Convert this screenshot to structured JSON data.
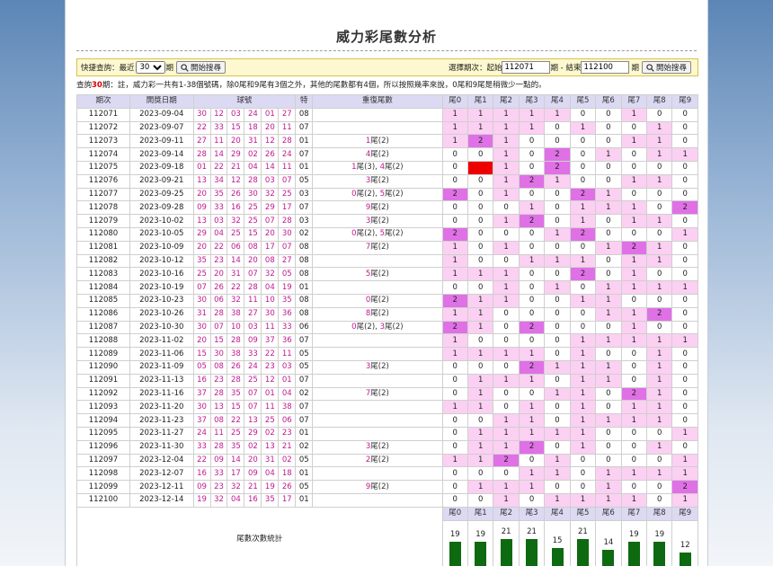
{
  "title": "威力彩尾數分析",
  "query": {
    "quick_label": "快捷查詢：最近",
    "quick_value": "30",
    "quick_options": [
      "30"
    ],
    "quick_suffix": "期",
    "search_label": "開始搜尋",
    "range_label": "選擇期次：起始",
    "range_start": "112071",
    "range_mid": "期 - 結束",
    "range_end": "112100",
    "range_suffix": "期"
  },
  "note": {
    "prefix": "查詢",
    "count": "30",
    "text": "期：註，威力彩一共有1-38個號碼，除0尾和9尾有3個之外，其他的尾數都有4個，所以按照幾率來說，0尾和9尾是稍微少一點的。"
  },
  "headers": [
    "期次",
    "開獎日期",
    "球號",
    "特",
    "重復尾數",
    "尾0",
    "尾1",
    "尾2",
    "尾3",
    "尾4",
    "尾5",
    "尾6",
    "尾7",
    "尾8",
    "尾9"
  ],
  "rows": [
    {
      "p": "112071",
      "d": "2023-09-04",
      "b": [
        "30",
        "12",
        "03",
        "24",
        "01",
        "27"
      ],
      "s": "08",
      "r": [],
      "t": [
        1,
        1,
        1,
        1,
        1,
        0,
        0,
        1,
        0,
        0
      ]
    },
    {
      "p": "112072",
      "d": "2023-09-07",
      "b": [
        "22",
        "33",
        "15",
        "18",
        "20",
        "11"
      ],
      "s": "07",
      "r": [],
      "t": [
        1,
        1,
        1,
        1,
        0,
        1,
        0,
        0,
        1,
        0
      ]
    },
    {
      "p": "112073",
      "d": "2023-09-11",
      "b": [
        "27",
        "11",
        "20",
        "31",
        "12",
        "28"
      ],
      "s": "01",
      "r": [
        {
          "n": "1",
          "c": "2"
        }
      ],
      "t": [
        1,
        2,
        1,
        0,
        0,
        0,
        0,
        1,
        1,
        0
      ]
    },
    {
      "p": "112074",
      "d": "2023-09-14",
      "b": [
        "28",
        "14",
        "29",
        "02",
        "26",
        "24"
      ],
      "s": "07",
      "r": [
        {
          "n": "4",
          "c": "2"
        }
      ],
      "t": [
        0,
        0,
        1,
        0,
        2,
        0,
        1,
        0,
        1,
        1
      ]
    },
    {
      "p": "112075",
      "d": "2023-09-18",
      "b": [
        "01",
        "22",
        "21",
        "04",
        "14",
        "11"
      ],
      "s": "01",
      "r": [
        {
          "n": "1",
          "c": "3"
        },
        {
          "n": "4",
          "c": "2"
        }
      ],
      "t": [
        0,
        3,
        1,
        0,
        2,
        0,
        0,
        0,
        0,
        0
      ]
    },
    {
      "p": "112076",
      "d": "2023-09-21",
      "b": [
        "13",
        "34",
        "12",
        "28",
        "03",
        "07"
      ],
      "s": "05",
      "r": [
        {
          "n": "3",
          "c": "2"
        }
      ],
      "t": [
        0,
        0,
        1,
        2,
        1,
        0,
        0,
        1,
        1,
        0
      ]
    },
    {
      "p": "112077",
      "d": "2023-09-25",
      "b": [
        "20",
        "35",
        "26",
        "30",
        "32",
        "25"
      ],
      "s": "03",
      "r": [
        {
          "n": "0",
          "c": "2"
        },
        {
          "n": "5",
          "c": "2"
        }
      ],
      "t": [
        2,
        0,
        1,
        0,
        0,
        2,
        1,
        0,
        0,
        0
      ]
    },
    {
      "p": "112078",
      "d": "2023-09-28",
      "b": [
        "09",
        "33",
        "16",
        "25",
        "29",
        "17"
      ],
      "s": "07",
      "r": [
        {
          "n": "9",
          "c": "2"
        }
      ],
      "t": [
        0,
        0,
        0,
        1,
        0,
        1,
        1,
        1,
        0,
        2
      ]
    },
    {
      "p": "112079",
      "d": "2023-10-02",
      "b": [
        "13",
        "03",
        "32",
        "25",
        "07",
        "28"
      ],
      "s": "03",
      "r": [
        {
          "n": "3",
          "c": "2"
        }
      ],
      "t": [
        0,
        0,
        1,
        2,
        0,
        1,
        0,
        1,
        1,
        0
      ]
    },
    {
      "p": "112080",
      "d": "2023-10-05",
      "b": [
        "29",
        "04",
        "25",
        "15",
        "20",
        "30"
      ],
      "s": "02",
      "r": [
        {
          "n": "0",
          "c": "2"
        },
        {
          "n": "5",
          "c": "2"
        }
      ],
      "t": [
        2,
        0,
        0,
        0,
        1,
        2,
        0,
        0,
        0,
        1
      ]
    },
    {
      "p": "112081",
      "d": "2023-10-09",
      "b": [
        "20",
        "22",
        "06",
        "08",
        "17",
        "07"
      ],
      "s": "08",
      "r": [
        {
          "n": "7",
          "c": "2"
        }
      ],
      "t": [
        1,
        0,
        1,
        0,
        0,
        0,
        1,
        2,
        1,
        0
      ]
    },
    {
      "p": "112082",
      "d": "2023-10-12",
      "b": [
        "35",
        "23",
        "14",
        "20",
        "08",
        "27"
      ],
      "s": "08",
      "r": [],
      "t": [
        1,
        0,
        0,
        1,
        1,
        1,
        0,
        1,
        1,
        0
      ]
    },
    {
      "p": "112083",
      "d": "2023-10-16",
      "b": [
        "25",
        "20",
        "31",
        "07",
        "32",
        "05"
      ],
      "s": "08",
      "r": [
        {
          "n": "5",
          "c": "2"
        }
      ],
      "t": [
        1,
        1,
        1,
        0,
        0,
        2,
        0,
        1,
        0,
        0
      ]
    },
    {
      "p": "112084",
      "d": "2023-10-19",
      "b": [
        "07",
        "26",
        "22",
        "28",
        "04",
        "19"
      ],
      "s": "01",
      "r": [],
      "t": [
        0,
        0,
        1,
        0,
        1,
        0,
        1,
        1,
        1,
        1
      ]
    },
    {
      "p": "112085",
      "d": "2023-10-23",
      "b": [
        "30",
        "06",
        "32",
        "11",
        "10",
        "35"
      ],
      "s": "08",
      "r": [
        {
          "n": "0",
          "c": "2"
        }
      ],
      "t": [
        2,
        1,
        1,
        0,
        0,
        1,
        1,
        0,
        0,
        0
      ]
    },
    {
      "p": "112086",
      "d": "2023-10-26",
      "b": [
        "31",
        "28",
        "38",
        "27",
        "30",
        "36"
      ],
      "s": "08",
      "r": [
        {
          "n": "8",
          "c": "2"
        }
      ],
      "t": [
        1,
        1,
        0,
        0,
        0,
        0,
        1,
        1,
        2,
        0
      ]
    },
    {
      "p": "112087",
      "d": "2023-10-30",
      "b": [
        "30",
        "07",
        "10",
        "03",
        "11",
        "33"
      ],
      "s": "06",
      "r": [
        {
          "n": "0",
          "c": "2"
        },
        {
          "n": "3",
          "c": "2"
        }
      ],
      "t": [
        2,
        1,
        0,
        2,
        0,
        0,
        0,
        1,
        0,
        0
      ]
    },
    {
      "p": "112088",
      "d": "2023-11-02",
      "b": [
        "20",
        "15",
        "28",
        "09",
        "37",
        "36"
      ],
      "s": "07",
      "r": [],
      "t": [
        1,
        0,
        0,
        0,
        0,
        1,
        1,
        1,
        1,
        1
      ]
    },
    {
      "p": "112089",
      "d": "2023-11-06",
      "b": [
        "15",
        "30",
        "38",
        "33",
        "22",
        "11"
      ],
      "s": "05",
      "r": [],
      "t": [
        1,
        1,
        1,
        1,
        0,
        1,
        0,
        0,
        1,
        0
      ]
    },
    {
      "p": "112090",
      "d": "2023-11-09",
      "b": [
        "05",
        "08",
        "26",
        "24",
        "23",
        "03"
      ],
      "s": "05",
      "r": [
        {
          "n": "3",
          "c": "2"
        }
      ],
      "t": [
        0,
        0,
        0,
        2,
        1,
        1,
        1,
        0,
        1,
        0
      ]
    },
    {
      "p": "112091",
      "d": "2023-11-13",
      "b": [
        "16",
        "23",
        "28",
        "25",
        "12",
        "01"
      ],
      "s": "07",
      "r": [],
      "t": [
        0,
        1,
        1,
        1,
        0,
        1,
        1,
        0,
        1,
        0
      ]
    },
    {
      "p": "112092",
      "d": "2023-11-16",
      "b": [
        "37",
        "28",
        "35",
        "07",
        "01",
        "04"
      ],
      "s": "02",
      "r": [
        {
          "n": "7",
          "c": "2"
        }
      ],
      "t": [
        0,
        1,
        0,
        0,
        1,
        1,
        0,
        2,
        1,
        0
      ]
    },
    {
      "p": "112093",
      "d": "2023-11-20",
      "b": [
        "30",
        "13",
        "15",
        "07",
        "11",
        "38"
      ],
      "s": "07",
      "r": [],
      "t": [
        1,
        1,
        0,
        1,
        0,
        1,
        0,
        1,
        1,
        0
      ]
    },
    {
      "p": "112094",
      "d": "2023-11-23",
      "b": [
        "37",
        "08",
        "22",
        "13",
        "25",
        "06"
      ],
      "s": "07",
      "r": [],
      "t": [
        0,
        0,
        1,
        1,
        0,
        1,
        1,
        1,
        1,
        0
      ]
    },
    {
      "p": "112095",
      "d": "2023-11-27",
      "b": [
        "24",
        "11",
        "25",
        "29",
        "02",
        "23"
      ],
      "s": "01",
      "r": [],
      "t": [
        0,
        1,
        1,
        1,
        1,
        1,
        0,
        0,
        0,
        1
      ]
    },
    {
      "p": "112096",
      "d": "2023-11-30",
      "b": [
        "33",
        "28",
        "35",
        "02",
        "13",
        "21"
      ],
      "s": "02",
      "r": [
        {
          "n": "3",
          "c": "2"
        }
      ],
      "t": [
        0,
        1,
        1,
        2,
        0,
        1,
        0,
        0,
        1,
        0
      ]
    },
    {
      "p": "112097",
      "d": "2023-12-04",
      "b": [
        "22",
        "09",
        "14",
        "20",
        "31",
        "02"
      ],
      "s": "05",
      "r": [
        {
          "n": "2",
          "c": "2"
        }
      ],
      "t": [
        1,
        1,
        2,
        0,
        1,
        0,
        0,
        0,
        0,
        1
      ]
    },
    {
      "p": "112098",
      "d": "2023-12-07",
      "b": [
        "16",
        "33",
        "17",
        "09",
        "04",
        "18"
      ],
      "s": "01",
      "r": [],
      "t": [
        0,
        0,
        0,
        1,
        1,
        0,
        1,
        1,
        1,
        1
      ]
    },
    {
      "p": "112099",
      "d": "2023-12-11",
      "b": [
        "09",
        "23",
        "32",
        "21",
        "19",
        "26"
      ],
      "s": "05",
      "r": [
        {
          "n": "9",
          "c": "2"
        }
      ],
      "t": [
        0,
        1,
        1,
        1,
        0,
        0,
        1,
        0,
        0,
        2
      ]
    },
    {
      "p": "112100",
      "d": "2023-12-14",
      "b": [
        "19",
        "32",
        "04",
        "16",
        "35",
        "17"
      ],
      "s": "01",
      "r": [],
      "t": [
        0,
        0,
        1,
        0,
        1,
        1,
        1,
        1,
        0,
        1
      ]
    }
  ],
  "stats": {
    "label": "尾數次數統計",
    "headers": [
      "尾0",
      "尾1",
      "尾2",
      "尾3",
      "尾4",
      "尾5",
      "尾6",
      "尾7",
      "尾8",
      "尾9"
    ],
    "counts": [
      19,
      19,
      21,
      21,
      15,
      21,
      14,
      19,
      19,
      12
    ]
  },
  "colors": {
    "one": "#fbd0f2",
    "two": "#e070e6",
    "three": "#ee0000",
    "bar": "#0e6a10",
    "header": "#dcd9f3"
  }
}
